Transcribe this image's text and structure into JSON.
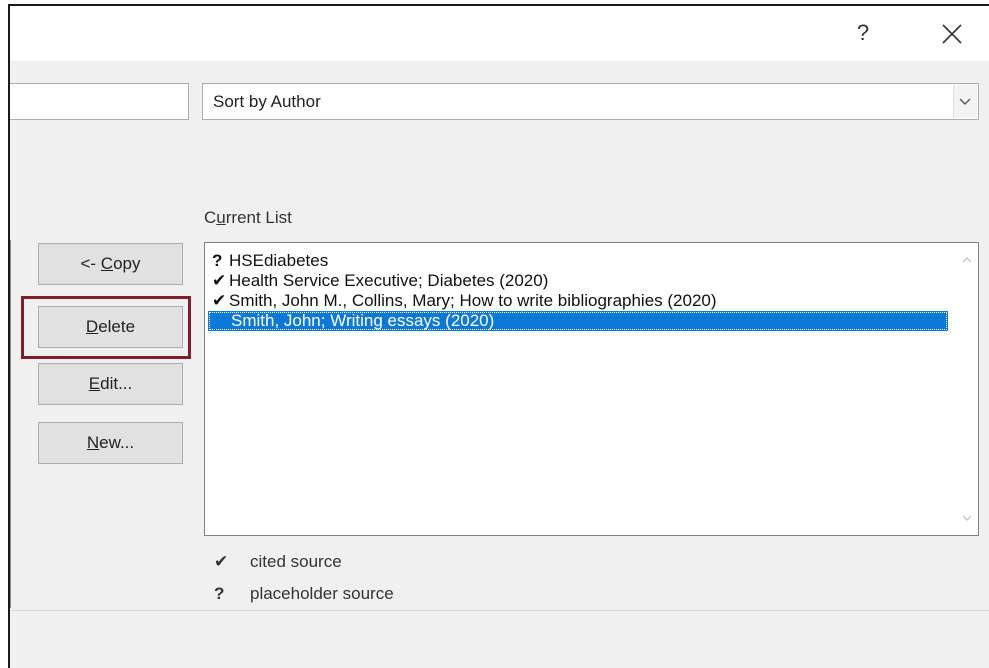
{
  "titlebar": {
    "help_label": "?",
    "close_icon": "close-icon"
  },
  "sort": {
    "selected": "Sort by Author",
    "arrow_icon": "chevron-down-icon"
  },
  "current_list": {
    "label_pre": "C",
    "label_u": "u",
    "label_post": "rrent List",
    "items": [
      {
        "mark": "?",
        "text": "HSEdiabetes",
        "selected": false
      },
      {
        "mark": "✔",
        "text": "Health Service Executive; Diabetes (2020)",
        "selected": false
      },
      {
        "mark": "✔",
        "text": "Smith, John M., Collins, Mary; How to write bibliographies (2020)",
        "selected": false
      },
      {
        "mark": "",
        "text": "Smith, John; Writing essays (2020)",
        "selected": true
      }
    ]
  },
  "buttons": {
    "copy": {
      "pre": "<- ",
      "u": "C",
      "post": "opy"
    },
    "delete": {
      "pre": "",
      "u": "D",
      "post": "elete"
    },
    "edit": {
      "pre": "",
      "u": "E",
      "post": "dit..."
    },
    "new": {
      "pre": "",
      "u": "N",
      "post": "ew..."
    }
  },
  "legend": {
    "cited_symbol": "✔",
    "cited_label": "cited source",
    "placeholder_symbol": "?",
    "placeholder_label": "placeholder source"
  },
  "colors": {
    "selection": "#0a78d7",
    "highlight_border": "#7a1f2b"
  }
}
